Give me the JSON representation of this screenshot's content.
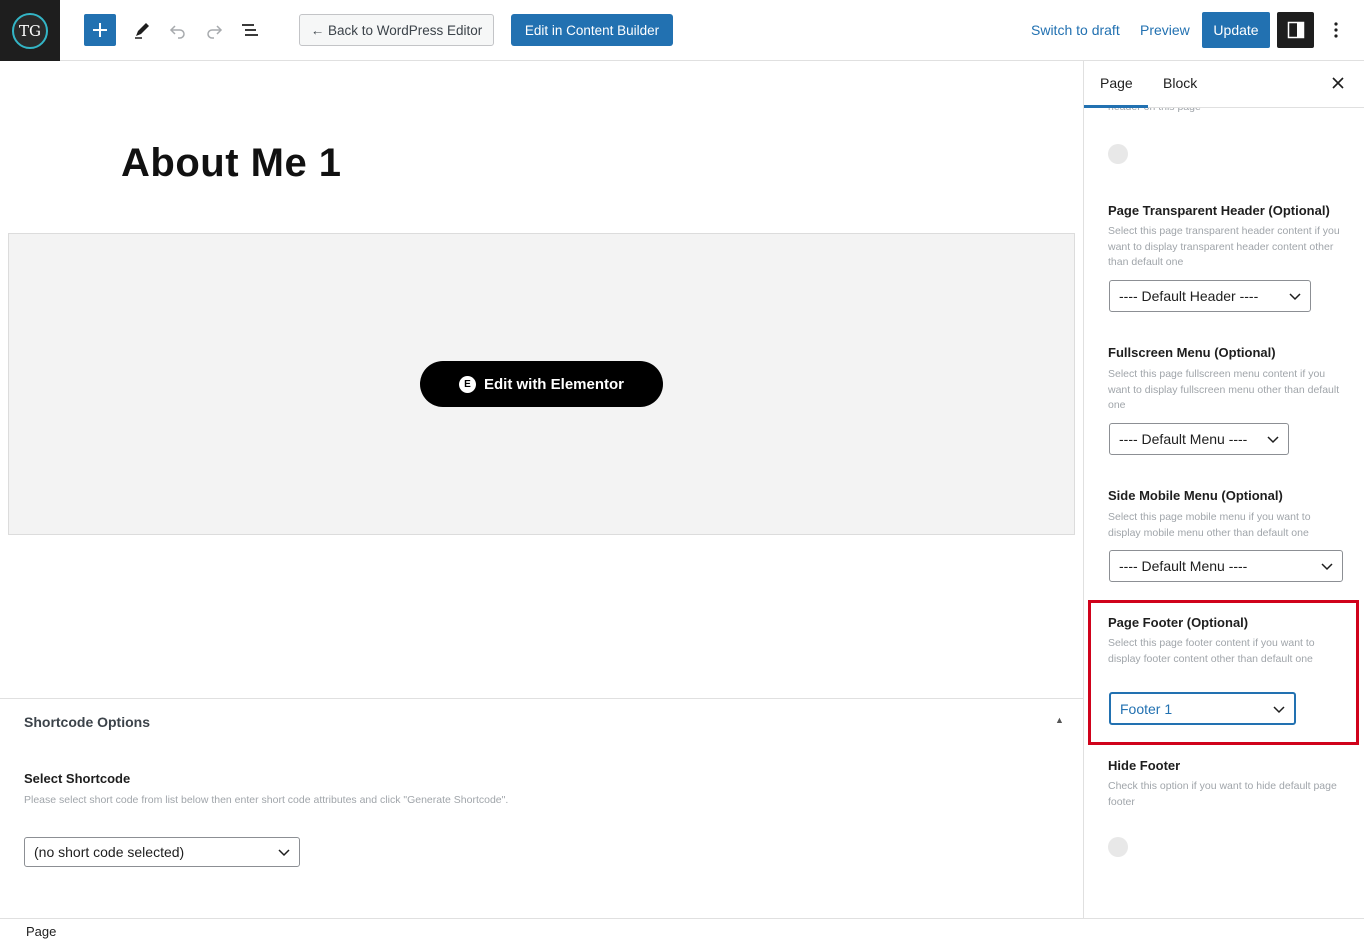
{
  "header": {
    "logo_text": "TG",
    "back_button": "← Back to WordPress Editor",
    "content_builder_button": "Edit in Content Builder",
    "switch_to_draft": "Switch to draft",
    "preview": "Preview",
    "update": "Update"
  },
  "canvas": {
    "page_title": "About Me 1",
    "elementor_button": "Edit with Elementor",
    "elementor_badge": "E"
  },
  "metabox": {
    "title": "Shortcode Options",
    "toggle_glyph": "▲",
    "select_label": "Select Shortcode",
    "select_help": "Please select short code from list below then enter short code attributes and click \"Generate Shortcode\".",
    "select_value": "(no short code selected)"
  },
  "sidebar": {
    "tabs": [
      "Page",
      "Block"
    ],
    "faded_text": "header on this page",
    "fields": [
      {
        "label": "Page Transparent Header (Optional)",
        "help": "Select this page transparent header content if you want to display transparent header content other than default one",
        "value": "---- Default Header ----"
      },
      {
        "label": "Fullscreen Menu (Optional)",
        "help": "Select this page fullscreen menu content if you want to display fullscreen menu other than default one",
        "value": "---- Default Menu ----"
      },
      {
        "label": "Side Mobile Menu (Optional)",
        "help": "Select this page mobile menu if you want to display mobile menu other than default one",
        "value": "---- Default Menu ----"
      },
      {
        "label": "Page Footer (Optional)",
        "help": "Select this page footer content if you want to display footer content other than default one",
        "value": "Footer 1"
      },
      {
        "label": "Hide Footer",
        "help": "Check this option if you want to hide default page footer"
      }
    ]
  },
  "statusbar": {
    "breadcrumb": "Page"
  },
  "colors": {
    "accent": "#2271b1",
    "highlight": "#d0021b",
    "dark": "#1e1e1e"
  }
}
